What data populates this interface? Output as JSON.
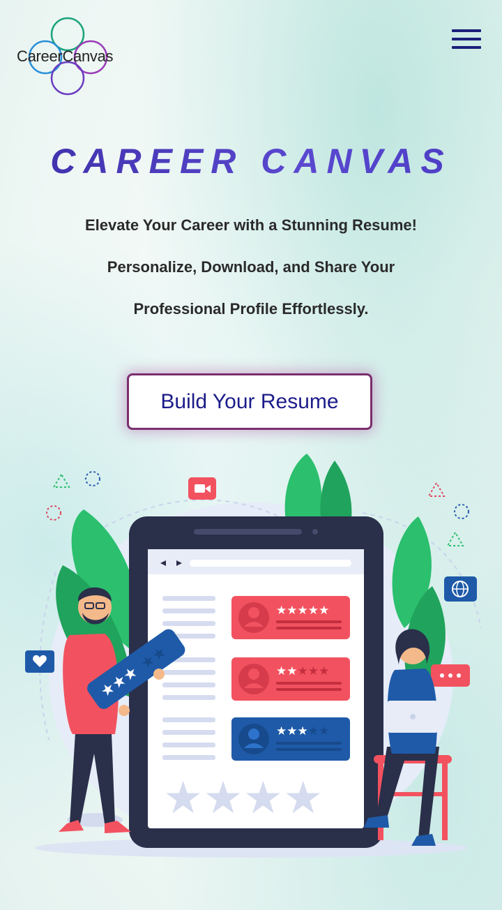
{
  "header": {
    "logo_text": "CareerCanvas",
    "menu_icon": "hamburger-menu-icon"
  },
  "hero": {
    "title": "CAREER CANVAS",
    "tagline_line1": "Elevate Your Career with a Stunning Resume!",
    "tagline_line2": "Personalize, Download, and Share Your",
    "tagline_line3": "Professional Profile Effortlessly.",
    "cta_label": "Build Your Resume"
  },
  "illustration": {
    "ratings_stars": [
      5,
      2,
      3
    ],
    "icons": [
      "video-icon",
      "heart-icon",
      "globe-icon",
      "chat-icon"
    ]
  },
  "colors": {
    "brand_purple": "#4a38b8",
    "cta_border": "#7a2e6e",
    "cta_text": "#1c1c8a",
    "menu": "#1a1f7a"
  }
}
